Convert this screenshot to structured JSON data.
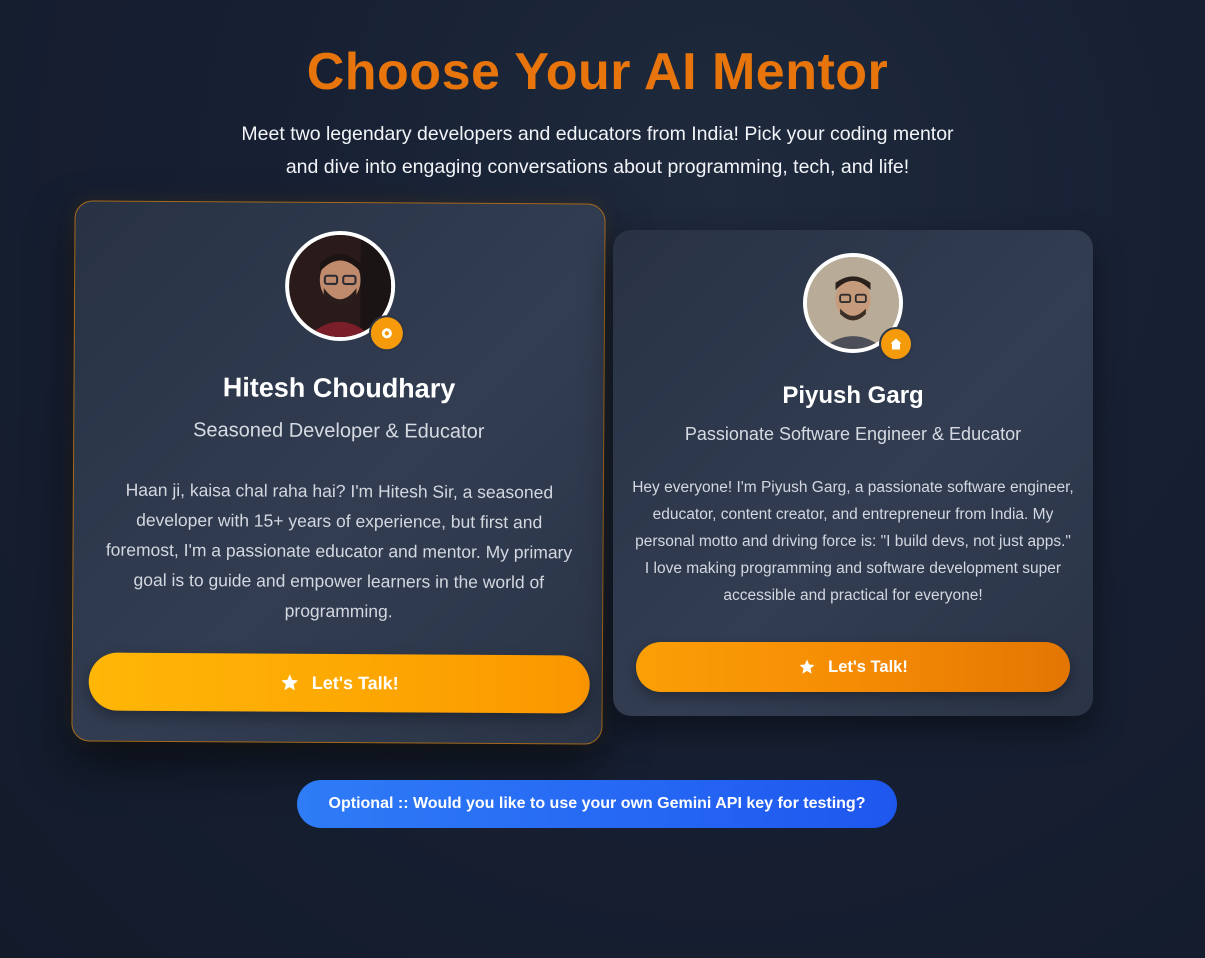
{
  "header": {
    "title": "Choose Your AI Mentor",
    "subtitle_line1": "Meet two legendary developers and educators from India! Pick your coding mentor",
    "subtitle_line2": "and dive into engaging conversations about programming, tech, and life!"
  },
  "mentors": [
    {
      "name": "Hitesh Choudhary",
      "role": "Seasoned Developer & Educator",
      "description": "Haan ji, kaisa chal raha hai? I'm Hitesh Sir, a seasoned developer with 15+ years of experience, but first and foremost, I'm a passionate educator and mentor. My primary goal is to guide and empower learners in the world of programming.",
      "button_label": "Let's Talk!",
      "badge_icon": "chai-cup-icon",
      "selected": true
    },
    {
      "name": "Piyush Garg",
      "role": "Passionate Software Engineer & Educator",
      "description": "Hey everyone! I'm Piyush Garg, a passionate software engineer, educator, content creator, and entrepreneur from India. My personal motto and driving force is: \"I build devs, not just apps.\" I love making programming and software development super accessible and practical for everyone!",
      "button_label": "Let's Talk!",
      "badge_icon": "home-icon",
      "selected": false
    }
  ],
  "api_key_prompt": {
    "label": "Optional :: Would you like to use your own Gemini API key for testing?"
  },
  "colors": {
    "title": "#e8750c",
    "badge": "#f59a0b",
    "talk_button": "#fda903",
    "api_button": "#2566f3",
    "selected_border": "#a46a1a"
  }
}
